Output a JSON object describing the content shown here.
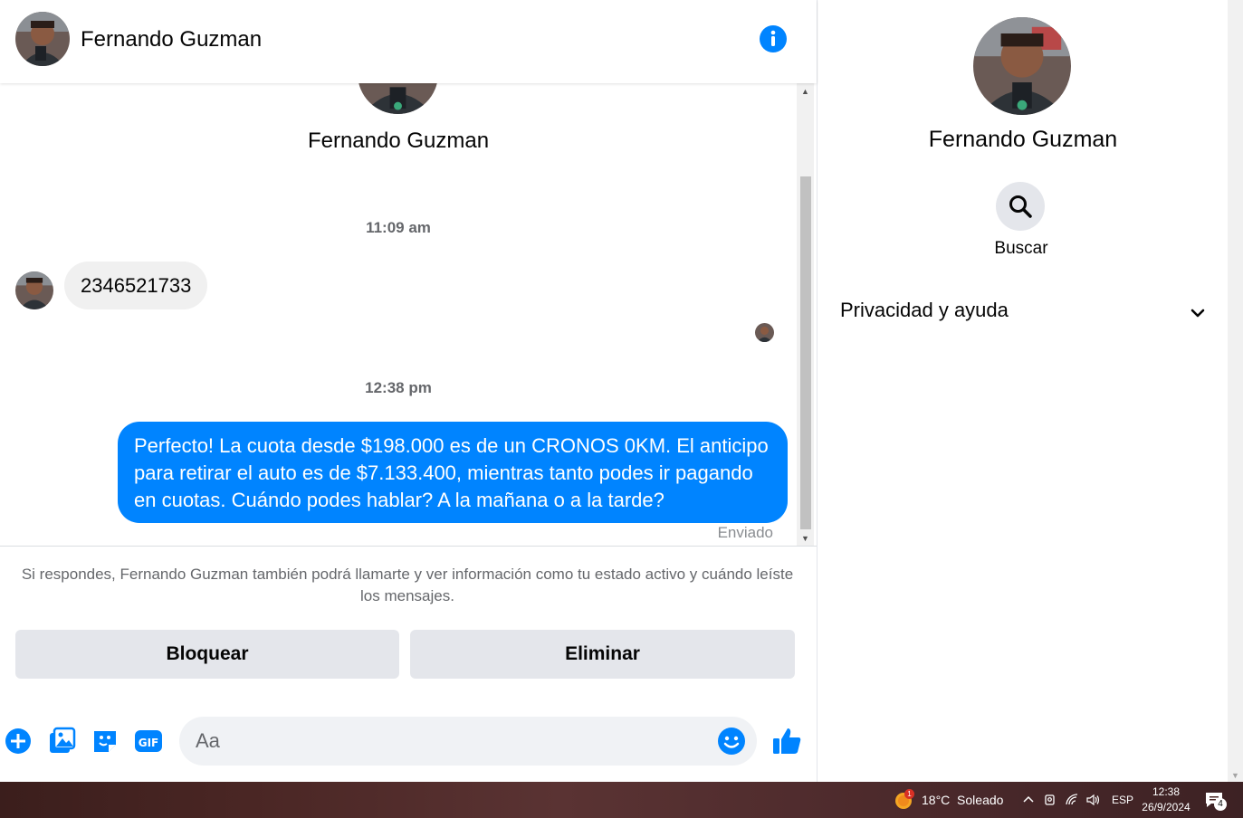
{
  "contact": {
    "name": "Fernando Guzman"
  },
  "header": {
    "name": "Fernando Guzman"
  },
  "messages": {
    "top_name": "Fernando Guzman",
    "groups": [
      {
        "time": "11:09 am",
        "received_text": "2346521733"
      },
      {
        "time": "12:38 pm",
        "sent_text": "Perfecto! La cuota desde $198.000 es de un CRONOS 0KM. El anticipo para retirar el auto es de $7.133.400, mientras tanto podes ir pagando en cuotas. Cuándo podes hablar? A la mañana o a la tarde?",
        "status": "Enviado"
      }
    ]
  },
  "notice": "Si respondes, Fernando Guzman también podrá llamarte y ver información como tu estado activo y cuándo leíste los mensajes.",
  "actions": {
    "block_label": "Bloquear",
    "delete_label": "Eliminar"
  },
  "composer": {
    "placeholder": "Aa"
  },
  "profile": {
    "name": "Fernando Guzman",
    "search_label": "Buscar",
    "privacy_label": "Privacidad y ayuda"
  },
  "taskbar": {
    "weather_badge": "1",
    "weather": "18°C  Soleado",
    "language": "ESP",
    "time": "12:38",
    "date": "26/9/2024",
    "notifications": "4"
  },
  "colors": {
    "accent": "#0084ff",
    "bubble_received": "#f0f0f0",
    "button_bg": "#e4e6eb"
  },
  "icons": [
    "info-icon",
    "search-icon",
    "chevron-down-icon",
    "plus-icon",
    "image-icon",
    "sticker-icon",
    "gif-icon",
    "emoji-icon",
    "like-icon"
  ]
}
